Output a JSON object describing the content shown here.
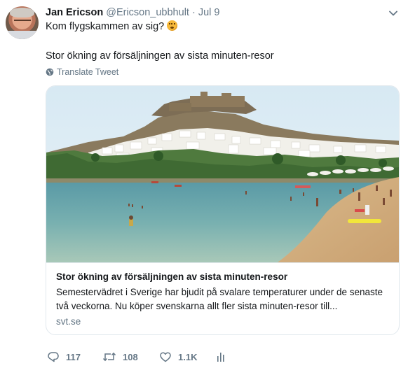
{
  "tweet": {
    "author_name": "Jan Ericson",
    "author_handle": "@Ericson_ubbhult",
    "separator": "·",
    "date": "Jul 9",
    "line1": "Kom flygskammen av sig?",
    "line1_emoji": "thinking-face-emoji",
    "line2": "Stor ökning av försäljningen av sista minuten-resor",
    "translate_label": "Translate Tweet"
  },
  "card": {
    "image": "beach-town-acropolis-photo",
    "title": "Stor ökning av försäljningen av sista minuten-resor",
    "description": "Semestervädret i Sverige har bjudit på svalare temperaturer under de senaste två veckorna. Nu köper svenskarna allt fler sista minuten-resor till...",
    "domain": "svt.se"
  },
  "actions": {
    "reply_count": "117",
    "retweet_count": "108",
    "like_count": "1.1K"
  },
  "icons": {
    "menu": "chevron-down-icon",
    "translate": "globe-icon",
    "reply": "reply-icon",
    "retweet": "retweet-icon",
    "like": "heart-icon",
    "analytics": "analytics-icon"
  },
  "colors": {
    "text": "#14171a",
    "secondary": "#657786",
    "border": "#e1e8ed"
  }
}
